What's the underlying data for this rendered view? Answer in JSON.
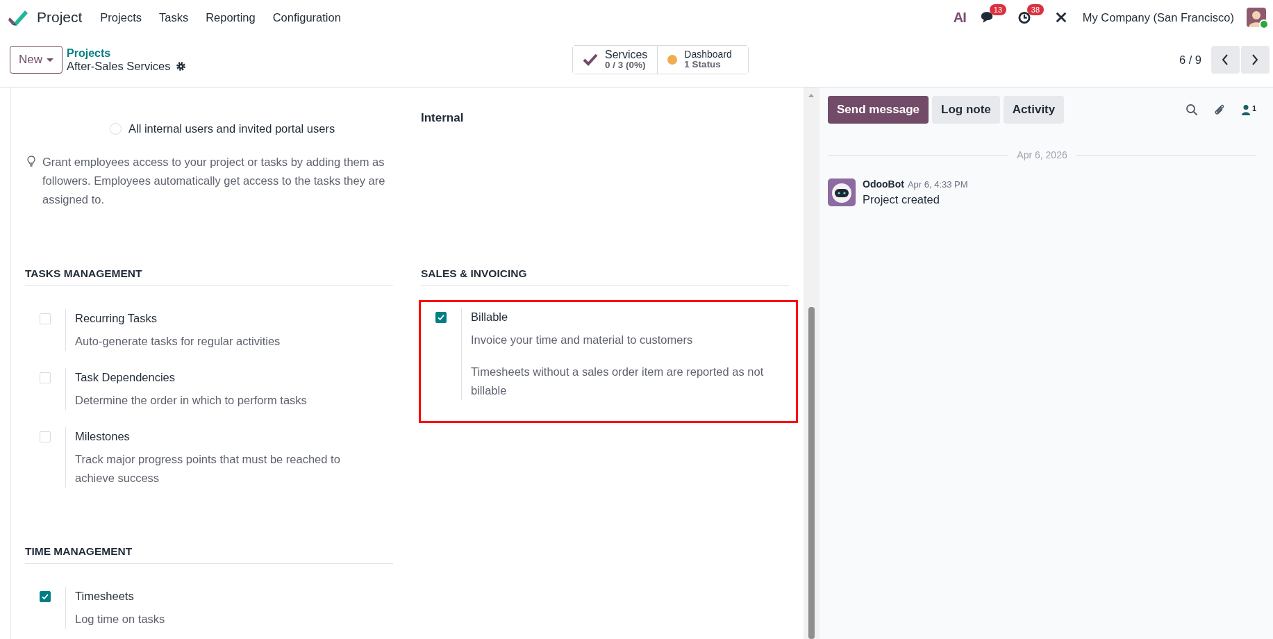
{
  "navbar": {
    "app_name": "Project",
    "menu": [
      "Projects",
      "Tasks",
      "Reporting",
      "Configuration"
    ],
    "ai_label": "AI",
    "messages_badge": "13",
    "activities_badge": "38",
    "company": "My Company (San Francisco)"
  },
  "control_panel": {
    "new_button": "New",
    "breadcrumb": "Projects",
    "record_title": "After-Sales Services",
    "stat_buttons": [
      {
        "kind": "check",
        "label": "Services",
        "value": "0 / 3 (0%)"
      },
      {
        "kind": "dot",
        "label": "Dashboard",
        "value": "1 Status",
        "color": "#f0ad4e"
      }
    ],
    "pager": "6 / 9"
  },
  "form": {
    "visibility_options": [
      {
        "label": "All internal users and invited portal users",
        "selected": false
      }
    ],
    "visibility_value": "Internal",
    "tip": "Grant employees access to your project or tasks by adding them as followers. Employees automatically get access to the tasks they are assigned to.",
    "section_rows": [
      {
        "left": {
          "title": "TASKS MANAGEMENT",
          "settings": [
            {
              "label": "Recurring Tasks",
              "descriptions": [
                "Auto-generate tasks for regular activities"
              ],
              "checked": false,
              "highlighted": false
            },
            {
              "label": "Task Dependencies",
              "descriptions": [
                "Determine the order in which to perform tasks"
              ],
              "checked": false,
              "highlighted": false
            },
            {
              "label": "Milestones",
              "descriptions": [
                "Track major progress points that must be reached to achieve success"
              ],
              "checked": false,
              "highlighted": false
            }
          ]
        },
        "right": {
          "title": "SALES & INVOICING",
          "settings": [
            {
              "label": "Billable",
              "descriptions": [
                "Invoice your time and material to customers",
                "Timesheets without a sales order item are reported as not billable"
              ],
              "checked": true,
              "highlighted": true
            }
          ]
        }
      },
      {
        "left": {
          "title": "TIME MANAGEMENT",
          "settings": [
            {
              "label": "Timesheets",
              "descriptions": [
                "Log time on tasks"
              ],
              "checked": true,
              "highlighted": false
            }
          ]
        }
      }
    ]
  },
  "chatter": {
    "buttons": [
      {
        "label": "Send message",
        "selected": true
      },
      {
        "label": "Log note",
        "selected": false
      },
      {
        "label": "Activity",
        "selected": false
      }
    ],
    "followers_count": "1",
    "date_separator": "Apr 6, 2026",
    "messages": [
      {
        "author": "OdooBot",
        "time": "Apr 6, 4:33 PM",
        "body": "Project created"
      }
    ]
  }
}
